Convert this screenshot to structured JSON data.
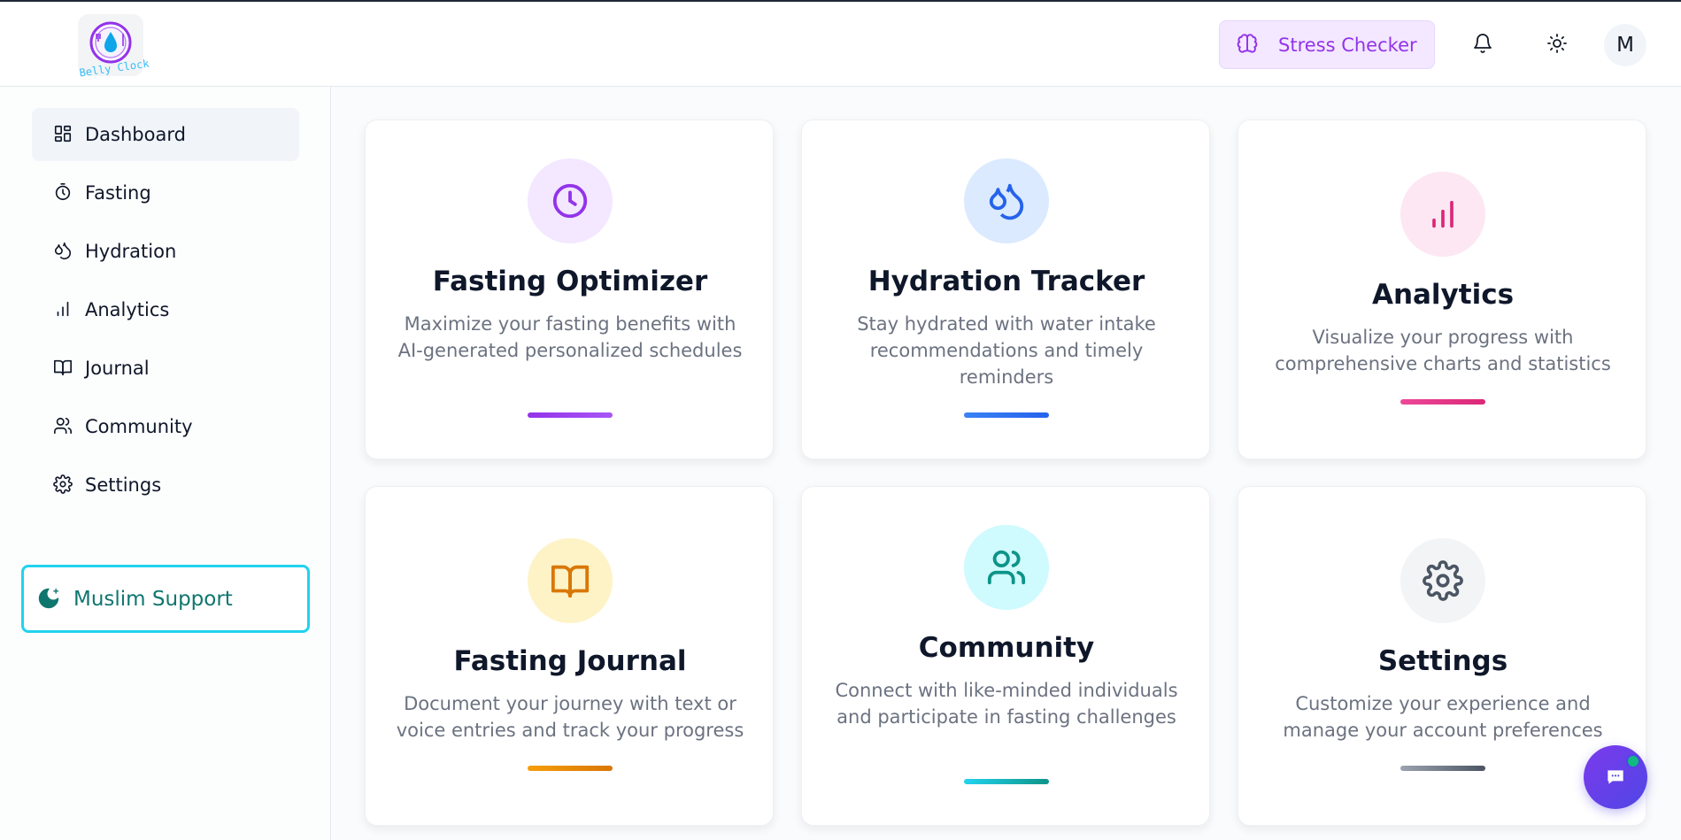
{
  "app": {
    "logo_text": "Belly Clock"
  },
  "header": {
    "stress_checker_label": "Stress Checker",
    "avatar_initial": "M"
  },
  "sidebar": {
    "items": [
      {
        "label": "Dashboard",
        "icon": "dashboard-icon",
        "active": true
      },
      {
        "label": "Fasting",
        "icon": "timer-icon",
        "active": false
      },
      {
        "label": "Hydration",
        "icon": "droplets-icon",
        "active": false
      },
      {
        "label": "Analytics",
        "icon": "bar-chart-icon",
        "active": false
      },
      {
        "label": "Journal",
        "icon": "book-icon",
        "active": false
      },
      {
        "label": "Community",
        "icon": "users-icon",
        "active": false
      },
      {
        "label": "Settings",
        "icon": "gear-icon",
        "active": false
      }
    ],
    "muslim_support_label": "Muslim Support"
  },
  "cards": [
    {
      "title": "Fasting Optimizer",
      "description": "Maximize your fasting benefits with AI-generated personalized schedules",
      "icon": "clock-icon",
      "accent": "#9333ea"
    },
    {
      "title": "Hydration Tracker",
      "description": "Stay hydrated with water intake recommendations and timely reminders",
      "icon": "droplets-icon",
      "accent": "#2563eb"
    },
    {
      "title": "Analytics",
      "description": "Visualize your progress with comprehensive charts and statistics",
      "icon": "bar-chart-icon",
      "accent": "#db2777"
    },
    {
      "title": "Fasting Journal",
      "description": "Document your journey with text or voice entries and track your progress",
      "icon": "book-icon",
      "accent": "#d97706"
    },
    {
      "title": "Community",
      "description": "Connect with like-minded individuals and participate in fasting challenges",
      "icon": "users-icon",
      "accent": "#0d9488"
    },
    {
      "title": "Settings",
      "description": "Customize your experience and manage your account preferences",
      "icon": "gear-icon",
      "accent": "#4b5563"
    }
  ],
  "colors": {
    "brand_purple": "#9333ea",
    "muslim_border": "#22d3ee",
    "chat_button": "#4f46e5"
  }
}
